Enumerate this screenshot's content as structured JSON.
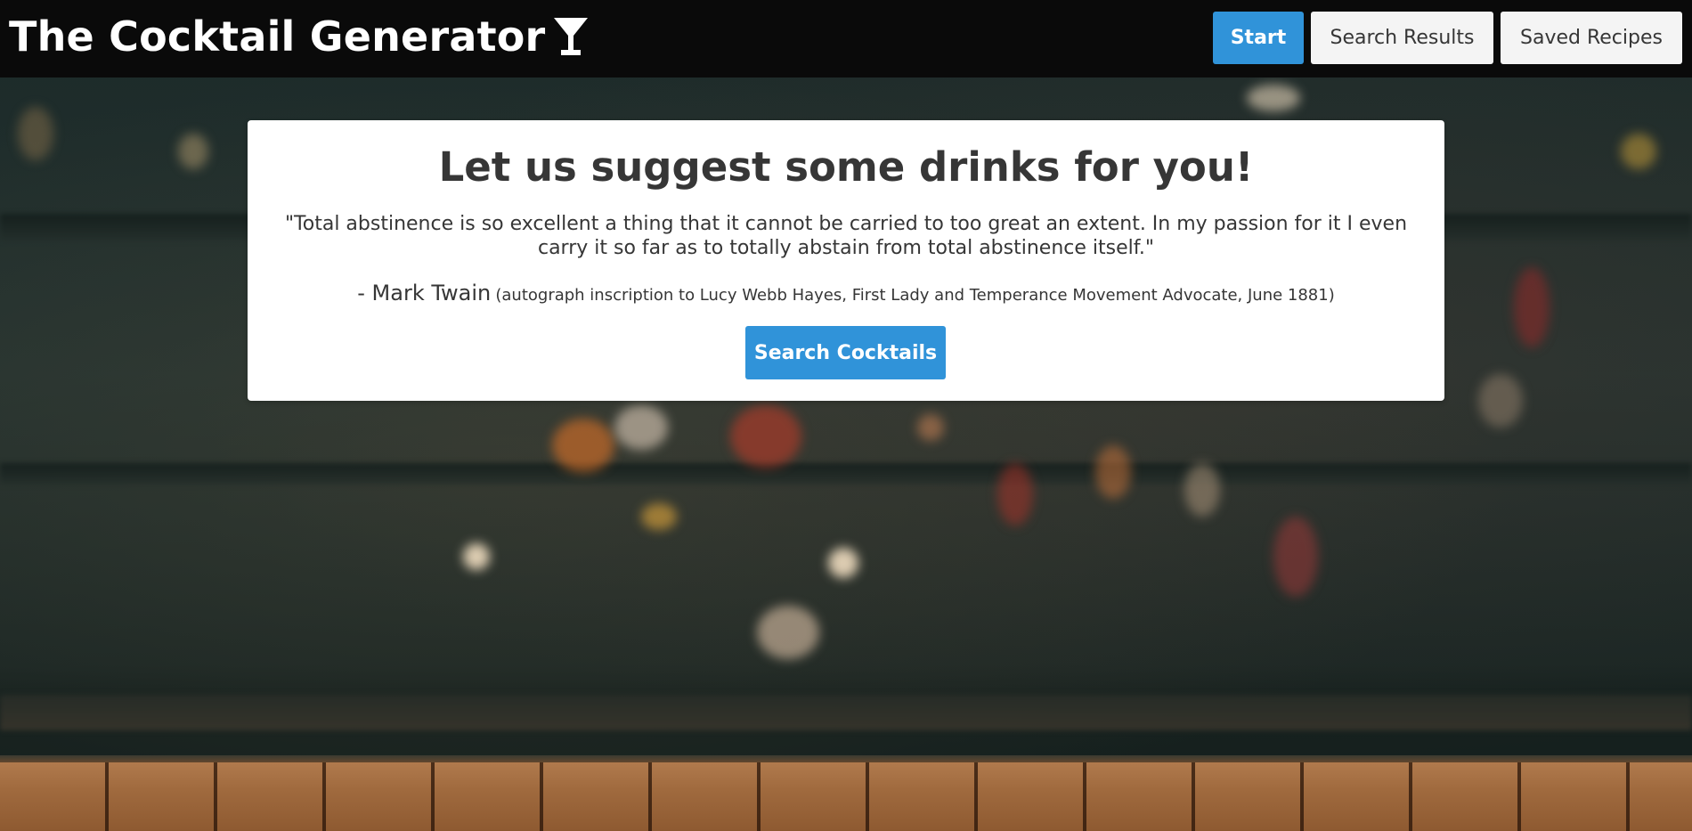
{
  "app": {
    "title": "The Cocktail Generator",
    "brand_icon": "cocktail-glass-icon"
  },
  "nav": {
    "items": [
      {
        "label": "Start",
        "active": true
      },
      {
        "label": "Search Results",
        "active": false
      },
      {
        "label": "Saved Recipes",
        "active": false
      }
    ]
  },
  "hero": {
    "heading": "Let us suggest some drinks for you!",
    "quote": "\"Total abstinence is so excellent a thing that it cannot be carried to too great an extent. In my passion for it I even carry it so far as to totally abstain from total abstinence itself.\"",
    "author": "- Mark Twain",
    "source": "(autograph inscription to Lucy Webb Hayes, First Lady and Temperance Movement Advocate, June 1881)",
    "cta_label": "Search Cocktails"
  },
  "colors": {
    "header_bg": "#0a0a0a",
    "accent": "#3093d9",
    "card_bg": "#ffffff",
    "text": "#363636",
    "secondary_button_bg": "#f4f4f4"
  }
}
